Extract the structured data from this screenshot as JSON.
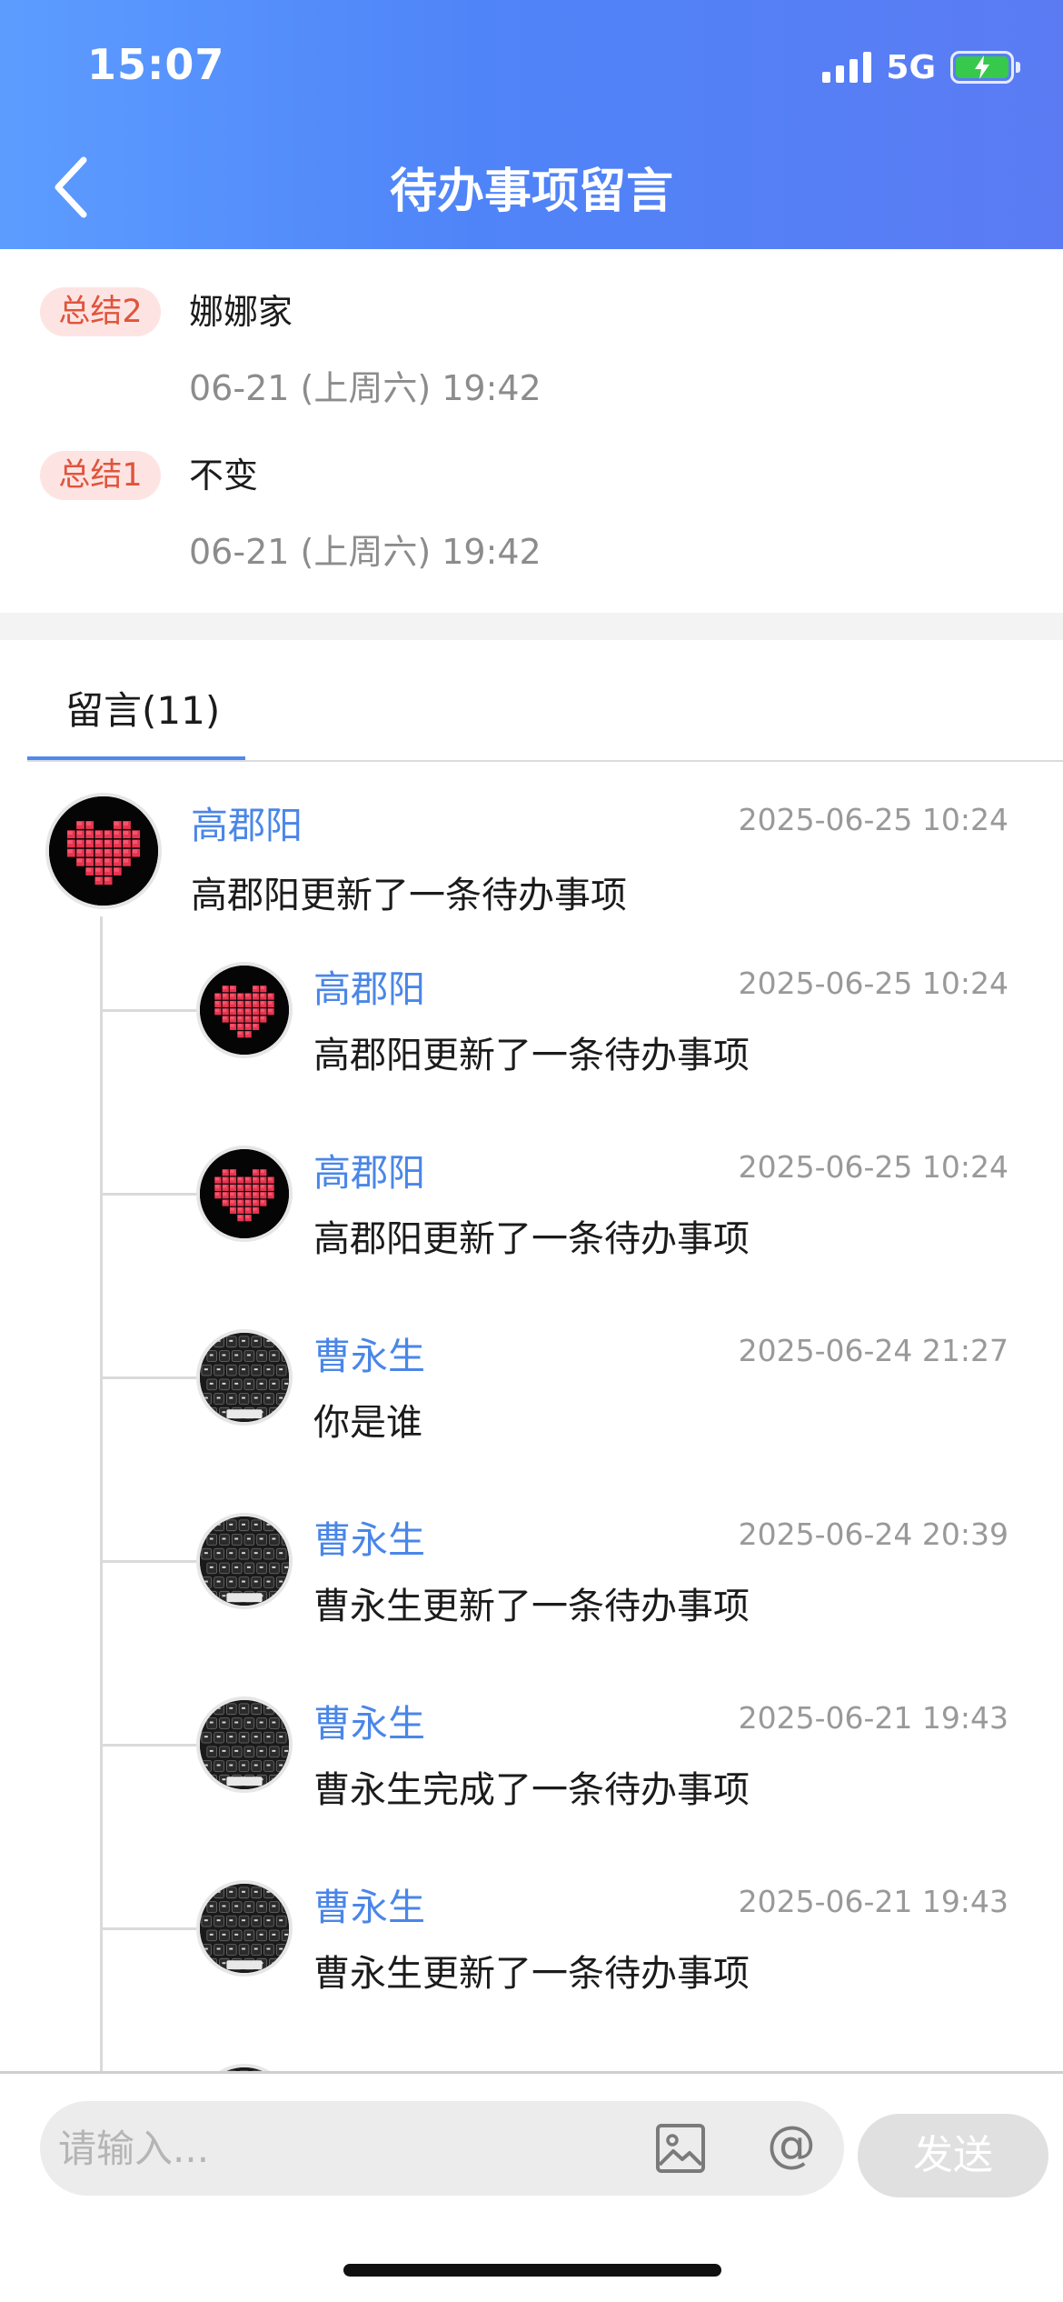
{
  "status": {
    "time": "15:07",
    "network": "5G"
  },
  "nav": {
    "title": "待办事项留言"
  },
  "summaries": [
    {
      "tag": "总结2",
      "text": "娜娜家",
      "time": "06-21 (上周六) 19:42"
    },
    {
      "tag": "总结1",
      "text": "不变",
      "time": "06-21 (上周六) 19:42"
    }
  ],
  "tab": {
    "label": "留言(11)"
  },
  "thread": {
    "root": {
      "name": "高郡阳",
      "time": "2025-06-25 10:24",
      "text": "高郡阳更新了一条待办事项",
      "avatar": "heart"
    },
    "replies": [
      {
        "name": "高郡阳",
        "time": "2025-06-25 10:24",
        "text": "高郡阳更新了一条待办事项",
        "avatar": "heart"
      },
      {
        "name": "高郡阳",
        "time": "2025-06-25 10:24",
        "text": "高郡阳更新了一条待办事项",
        "avatar": "heart"
      },
      {
        "name": "曹永生",
        "time": "2025-06-24 21:27",
        "text": "你是谁",
        "avatar": "keyboard"
      },
      {
        "name": "曹永生",
        "time": "2025-06-24 20:39",
        "text": "曹永生更新了一条待办事项",
        "avatar": "keyboard"
      },
      {
        "name": "曹永生",
        "time": "2025-06-21 19:43",
        "text": "曹永生完成了一条待办事项",
        "avatar": "keyboard"
      },
      {
        "name": "曹永生",
        "time": "2025-06-21 19:43",
        "text": "曹永生更新了一条待办事项",
        "avatar": "keyboard"
      }
    ]
  },
  "composer": {
    "placeholder": "请输入...",
    "at_symbol": "@",
    "send_label": "发送"
  },
  "colors": {
    "accent": "#4a86e8",
    "header_start": "#5c9cff",
    "header_end": "#5b7bf3",
    "tag_bg": "#fde4e2",
    "tag_text": "#e0543c"
  }
}
